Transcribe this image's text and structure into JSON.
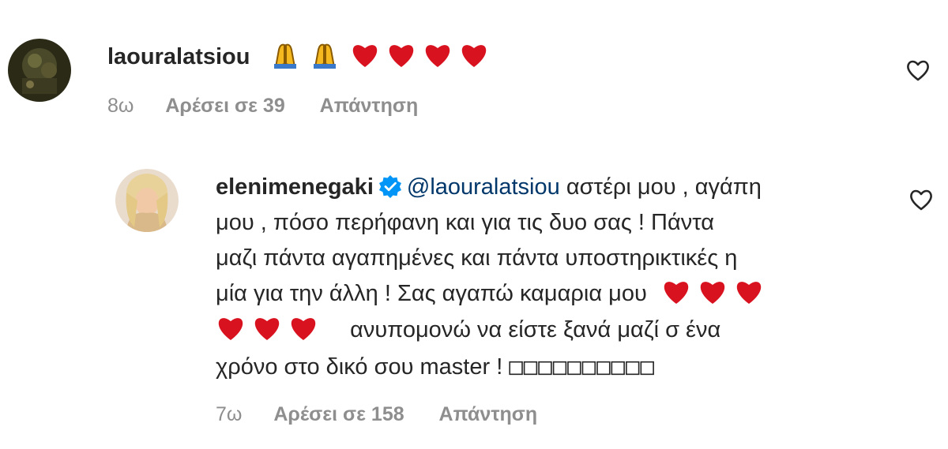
{
  "comment1": {
    "username": "laouralatsiou",
    "emoji": [
      "folded-hands-emoji",
      "folded-hands-emoji",
      "red-heart-emoji",
      "red-heart-emoji",
      "red-heart-emoji",
      "red-heart-emoji"
    ],
    "time": "8ω",
    "likes": "Αρέσει σε 39",
    "reply": "Απάντηση"
  },
  "comment2": {
    "username": "elenimenegaki",
    "mention": "@laouralatsiou",
    "line1": " αστέρι μου , αγάπη",
    "line2": "μου , πόσο περήφανη και για τις δυο σας ! Πάντα",
    "line3": "μαζι πάντα αγαπημένες και πάντα υποστηρικτικές η",
    "line4": "μία για την άλλη ! Σας αγαπώ καμαρια μου",
    "line5": "ανυπομονώ να είστε ξανά μαζί σ ένα",
    "line6_text": "χρόνο στο δικό σου master ! ",
    "line6_tofu": "□□□□□□□□□□",
    "time": "7ω",
    "likes": "Αρέσει σε 158",
    "reply": "Απάντηση"
  },
  "colors": {
    "username": "#262626",
    "mention": "#00376b",
    "meta": "#8e8e8e",
    "heart_emoji": "#d9121f",
    "verified": "#0095f6"
  },
  "icons": {
    "like": "heart-outline-icon",
    "verified": "verified-badge-icon"
  }
}
